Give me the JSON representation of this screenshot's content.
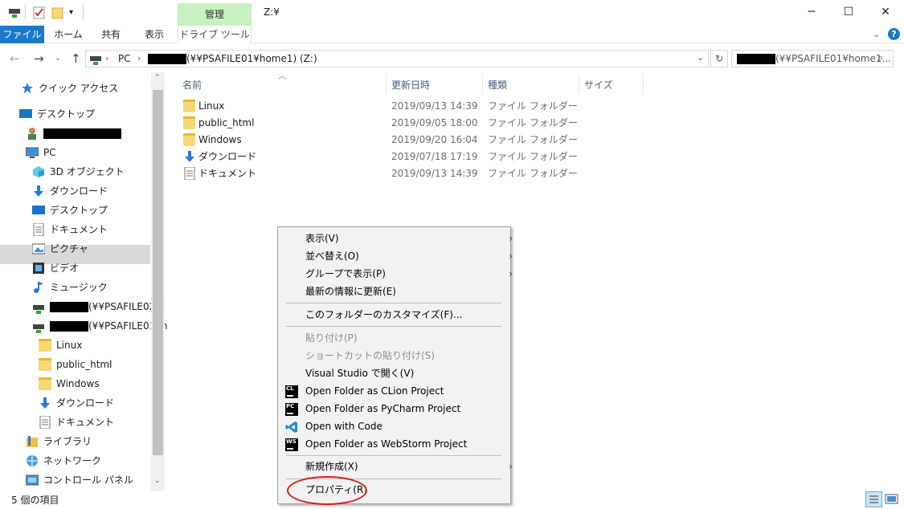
{
  "titlebar": {
    "contextual_tab": "管理",
    "window_title": "Z:¥"
  },
  "ribbon": {
    "tabs": [
      {
        "label": "ファイル",
        "active": true
      },
      {
        "label": "ホーム"
      },
      {
        "label": "共有"
      },
      {
        "label": "表示"
      },
      {
        "label": "ドライブ ツール"
      }
    ]
  },
  "address": {
    "crumbs": [
      "PC",
      "(¥¥PSAFILE01¥home1) (Z:)"
    ],
    "search_placeholder": "(¥¥PSAFILE01¥home1..."
  },
  "nav": {
    "items": [
      {
        "label": "クイック アクセス",
        "icon": "star-icon"
      },
      {
        "label": "デスクトップ",
        "icon": "desktop-icon"
      },
      {
        "label": "",
        "icon": "user-icon",
        "redacted": true
      },
      {
        "label": "PC",
        "icon": "pc-icon"
      },
      {
        "label": "3D オブジェクト",
        "icon": "cube-icon"
      },
      {
        "label": "ダウンロード",
        "icon": "download-icon"
      },
      {
        "label": "デスクトップ",
        "icon": "desktop-icon"
      },
      {
        "label": "ドキュメント",
        "icon": "document-icon"
      },
      {
        "label": "ピクチャ",
        "icon": "picture-icon"
      },
      {
        "label": "ビデオ",
        "icon": "video-icon"
      },
      {
        "label": "ミュージック",
        "icon": "music-icon"
      },
      {
        "label": "(¥¥PSAFILE02) (",
        "icon": "network-drive-icon"
      },
      {
        "label": "(¥¥PSAFILE01¥h",
        "icon": "network-drive-icon",
        "selected": true
      },
      {
        "label": "Linux",
        "icon": "folder-icon"
      },
      {
        "label": "public_html",
        "icon": "folder-icon"
      },
      {
        "label": "Windows",
        "icon": "folder-icon"
      },
      {
        "label": "ダウンロード",
        "icon": "download-icon"
      },
      {
        "label": "ドキュメント",
        "icon": "document-icon"
      },
      {
        "label": "ライブラリ",
        "icon": "library-icon"
      },
      {
        "label": "ネットワーク",
        "icon": "network-icon"
      },
      {
        "label": "コントロール パネル",
        "icon": "control-panel-icon"
      }
    ]
  },
  "filelist": {
    "columns": [
      "名前",
      "更新日時",
      "種類",
      "サイズ"
    ],
    "rows": [
      {
        "name": "Linux",
        "date": "2019/09/13 14:39",
        "type": "ファイル フォルダー",
        "icon": "folder-icon"
      },
      {
        "name": "public_html",
        "date": "2019/09/05 18:00",
        "type": "ファイル フォルダー",
        "icon": "folder-icon"
      },
      {
        "name": "Windows",
        "date": "2019/09/20 16:04",
        "type": "ファイル フォルダー",
        "icon": "folder-icon"
      },
      {
        "name": "ダウンロード",
        "date": "2019/07/18 17:19",
        "type": "ファイル フォルダー",
        "icon": "download-icon"
      },
      {
        "name": "ドキュメント",
        "date": "2019/09/13 14:39",
        "type": "ファイル フォルダー",
        "icon": "document-icon"
      }
    ]
  },
  "context_menu": {
    "items": [
      {
        "label": "表示(V)",
        "submenu": true
      },
      {
        "label": "並べ替え(O)",
        "submenu": true
      },
      {
        "label": "グループで表示(P)",
        "submenu": true
      },
      {
        "label": "最新の情報に更新(E)"
      },
      {
        "label": "このフォルダーのカスタマイズ(F)..."
      },
      {
        "label": "貼り付け(P)",
        "disabled": true
      },
      {
        "label": "ショートカットの貼り付け(S)",
        "disabled": true
      },
      {
        "label": "Visual Studio で開く(V)"
      },
      {
        "label": "Open Folder as CLion Project",
        "icon_text": "CL"
      },
      {
        "label": "Open Folder as PyCharm Project",
        "icon_text": "PC"
      },
      {
        "label": "Open with Code",
        "icon": "vscode-icon"
      },
      {
        "label": "Open Folder as WebStorm Project",
        "icon_text": "WS"
      },
      {
        "label": "新規作成(X)",
        "submenu": true
      },
      {
        "label": "プロパティ(R)",
        "highlighted": true
      }
    ]
  },
  "status": {
    "item_count": "5 個の項目"
  },
  "colors": {
    "accent": "#1979ca",
    "contextual": "#c9f0c0",
    "highlight_circle": "#d81c1c"
  }
}
